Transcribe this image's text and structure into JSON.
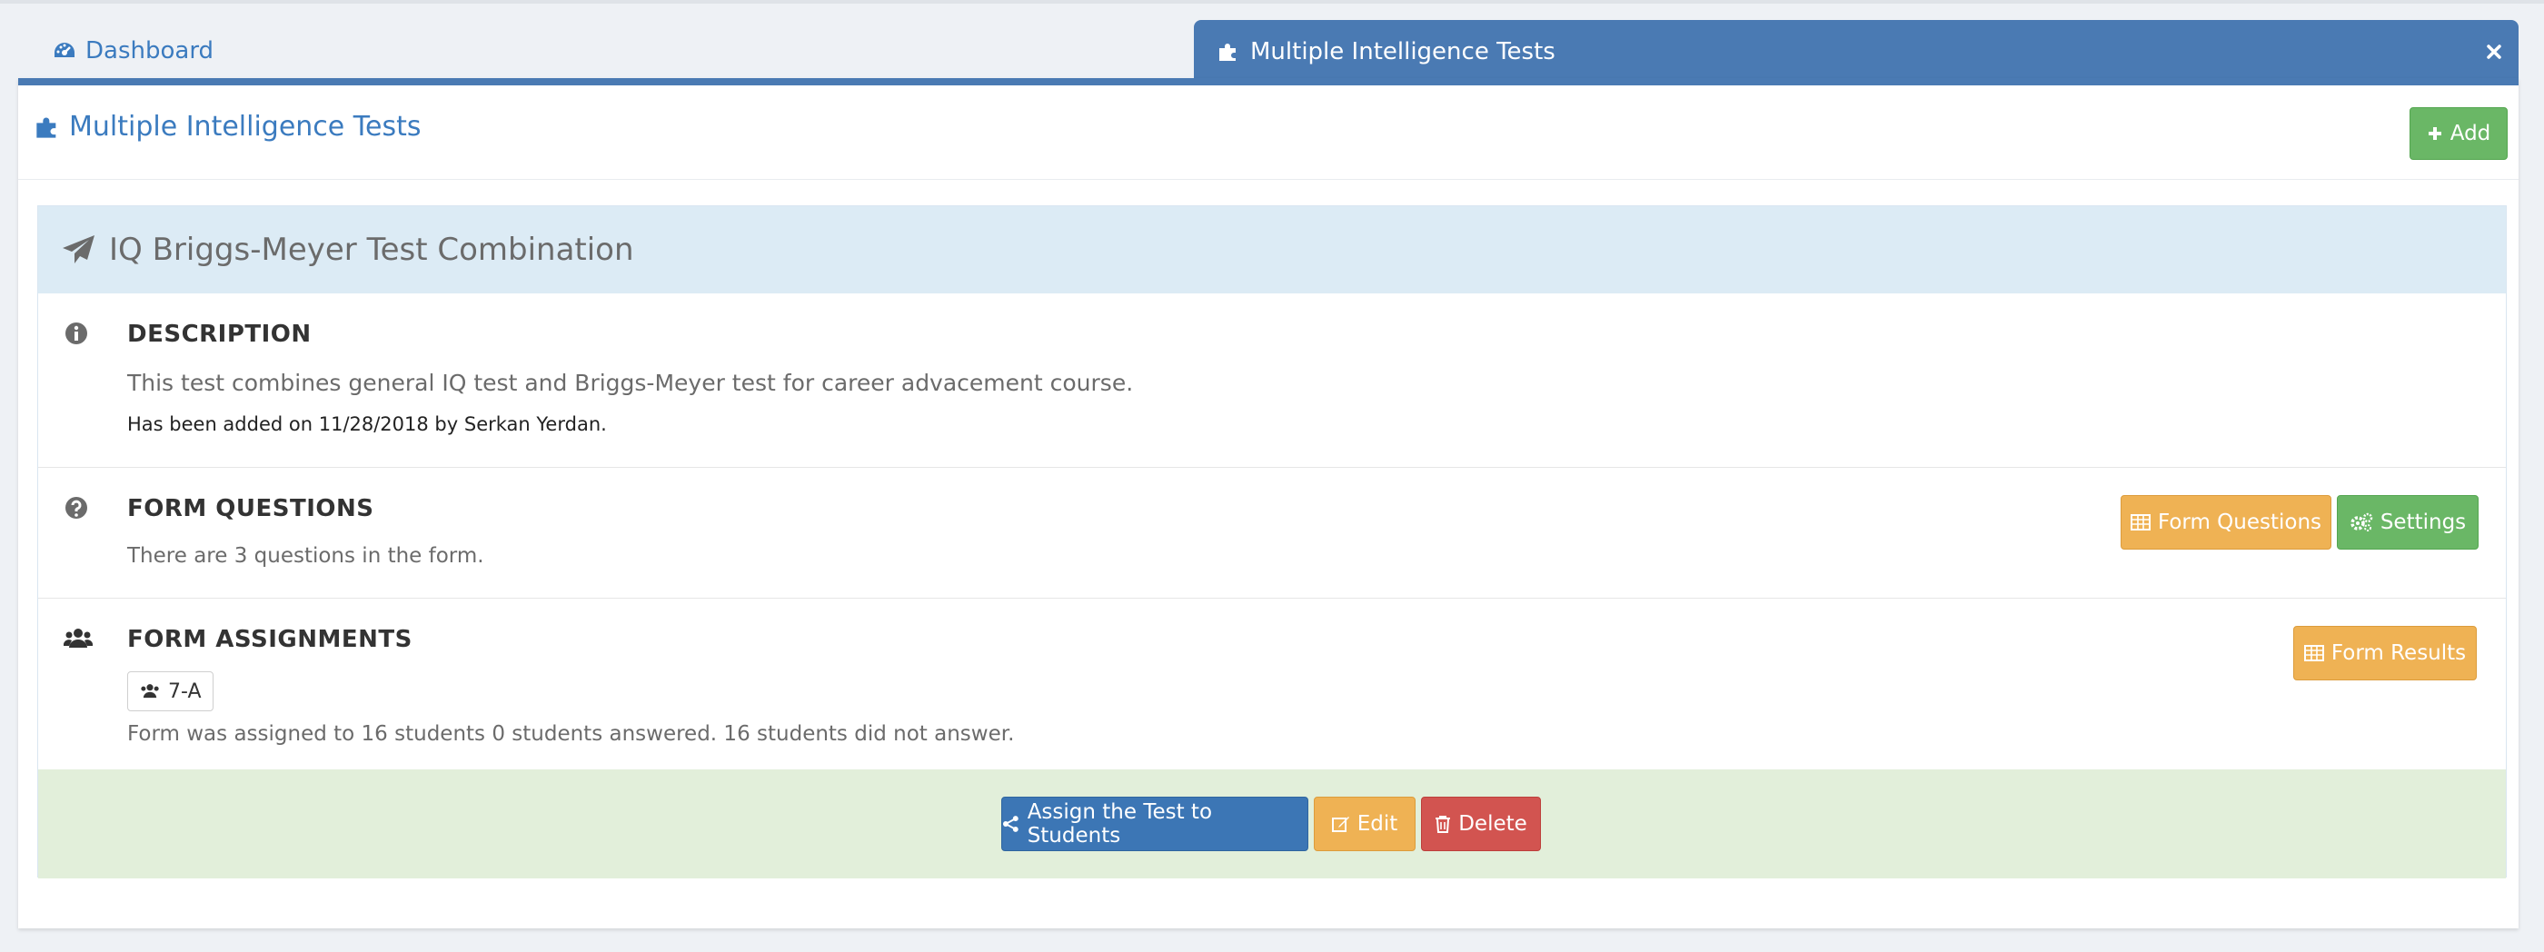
{
  "tabs": {
    "dashboard_label": "Dashboard",
    "active_label": "Multiple Intelligence Tests"
  },
  "panel": {
    "title": "Multiple Intelligence Tests",
    "add_label": "Add"
  },
  "test": {
    "title": "IQ Briggs-Meyer Test Combination",
    "description": {
      "heading": "DESCRIPTION",
      "text": "This test combines general IQ test and Briggs-Meyer test for career advacement course.",
      "added_info": "Has been added on 11/28/2018 by Serkan Yerdan."
    },
    "questions": {
      "heading": "FORM QUESTIONS",
      "text": "There are 3 questions in the form.",
      "form_questions_label": "Form Questions",
      "settings_label": "Settings"
    },
    "assignments": {
      "heading": "FORM ASSIGNMENTS",
      "group": "7-A",
      "text": "Form was assigned to 16 students 0 students answered. 16 students did not answer.",
      "form_results_label": "Form Results"
    },
    "actions": {
      "assign_label": "Assign the Test to Students",
      "edit_label": "Edit",
      "delete_label": "Delete"
    }
  },
  "colors": {
    "primary": "#4a7ab3",
    "link": "#3b7bbf",
    "success": "#6ab766",
    "warning": "#efb254",
    "danger": "#d25450",
    "info_bg": "#dcebf5",
    "success_bg": "#e2efda"
  },
  "icons": {
    "dashboard": "dashboard-icon",
    "module": "puzzle-icon",
    "close": "close-icon",
    "add": "plus-icon",
    "test": "paper-plane-icon",
    "description": "info-icon",
    "questions": "question-icon",
    "assignments": "users-icon",
    "table": "table-icon",
    "settings": "cogs-icon",
    "share": "share-icon",
    "edit": "edit-icon",
    "delete": "trash-icon"
  }
}
